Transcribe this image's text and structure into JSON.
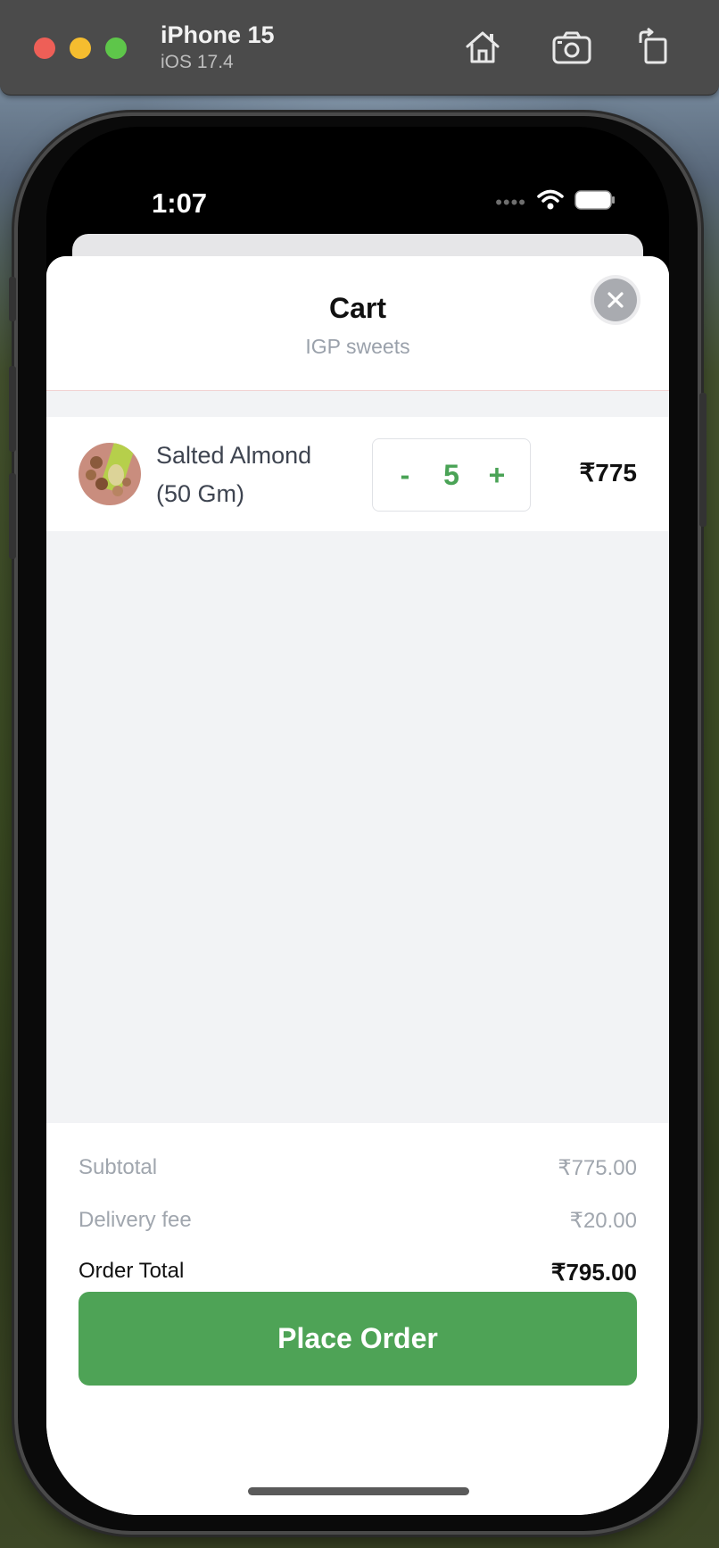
{
  "simulator": {
    "device_name": "iPhone 15",
    "os_version": "iOS 17.4",
    "toolbar_icons": [
      "home-icon",
      "screenshot-icon",
      "rotate-icon"
    ]
  },
  "status_bar": {
    "time": "1:07",
    "icons": [
      "signal-dots-icon",
      "wifi-icon",
      "battery-icon"
    ]
  },
  "cart": {
    "title": "Cart",
    "subtitle": "IGP sweets",
    "close_icon": "close-icon",
    "items": [
      {
        "name": "Salted Almond (50 Gm)",
        "quantity": "5",
        "decrement_label": "-",
        "increment_label": "+",
        "price": "₹775"
      }
    ]
  },
  "summary": {
    "subtotal_label": "Subtotal",
    "subtotal_value": "₹775.00",
    "delivery_label": "Delivery fee",
    "delivery_value": "₹20.00",
    "total_label": "Order Total",
    "total_value": "₹795.00"
  },
  "place_order_label": "Place Order",
  "colors": {
    "accent_green": "#4ea356",
    "muted_text": "#a0a6ae",
    "list_bg": "#f2f3f5"
  }
}
